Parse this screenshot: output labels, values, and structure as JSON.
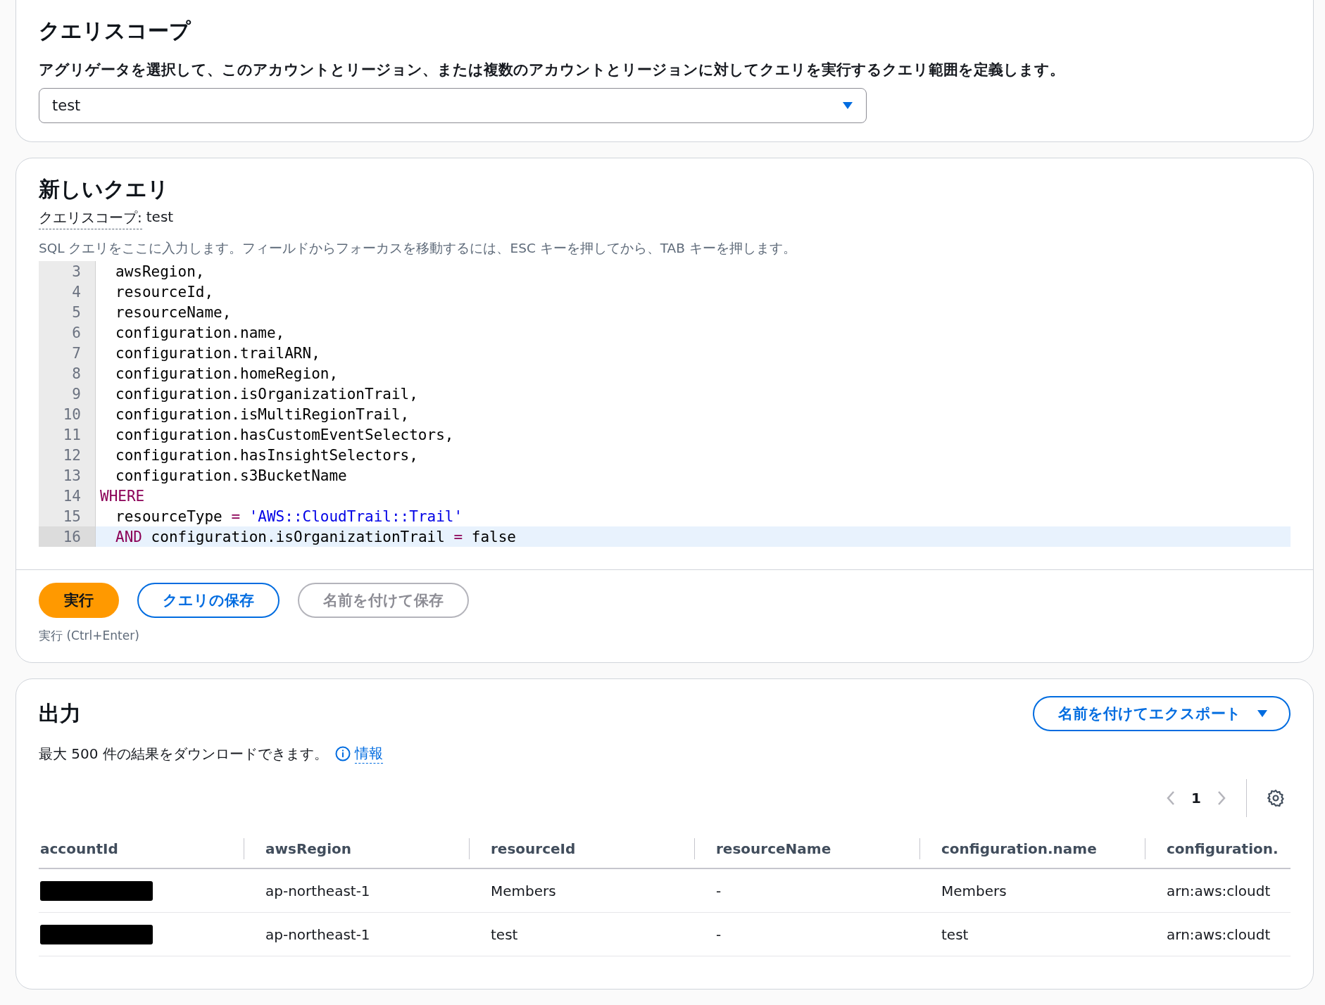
{
  "scope_panel": {
    "title": "クエリスコープ",
    "description": "アグリゲータを選択して、このアカウントとリージョン、または複数のアカウントとリージョンに対してクエリを実行するクエリ範囲を定義します。",
    "select_value": "test"
  },
  "query_panel": {
    "title": "新しいクエリ",
    "scope_label": "クエリスコープ:",
    "scope_value": "test",
    "editor_hint": "SQL クエリをここに入力します。フィールドからフォーカスを移動するには、ESC キーを押してから、TAB キーを押します。",
    "code_lines": [
      {
        "number": "3",
        "indent": true,
        "active": false,
        "tokens": [
          {
            "kind": "plain",
            "text": "awsRegion,"
          }
        ]
      },
      {
        "number": "4",
        "indent": true,
        "active": false,
        "tokens": [
          {
            "kind": "plain",
            "text": "resourceId,"
          }
        ]
      },
      {
        "number": "5",
        "indent": true,
        "active": false,
        "tokens": [
          {
            "kind": "plain",
            "text": "resourceName,"
          }
        ]
      },
      {
        "number": "6",
        "indent": true,
        "active": false,
        "tokens": [
          {
            "kind": "plain",
            "text": "configuration.name,"
          }
        ]
      },
      {
        "number": "7",
        "indent": true,
        "active": false,
        "tokens": [
          {
            "kind": "plain",
            "text": "configuration.trailARN,"
          }
        ]
      },
      {
        "number": "8",
        "indent": true,
        "active": false,
        "tokens": [
          {
            "kind": "plain",
            "text": "configuration.homeRegion,"
          }
        ]
      },
      {
        "number": "9",
        "indent": true,
        "active": false,
        "tokens": [
          {
            "kind": "plain",
            "text": "configuration.isOrganizationTrail,"
          }
        ]
      },
      {
        "number": "10",
        "indent": true,
        "active": false,
        "tokens": [
          {
            "kind": "plain",
            "text": "configuration.isMultiRegionTrail,"
          }
        ]
      },
      {
        "number": "11",
        "indent": true,
        "active": false,
        "tokens": [
          {
            "kind": "plain",
            "text": "configuration.hasCustomEventSelectors,"
          }
        ]
      },
      {
        "number": "12",
        "indent": true,
        "active": false,
        "tokens": [
          {
            "kind": "plain",
            "text": "configuration.hasInsightSelectors,"
          }
        ]
      },
      {
        "number": "13",
        "indent": true,
        "active": false,
        "tokens": [
          {
            "kind": "plain",
            "text": "configuration.s3BucketName"
          }
        ]
      },
      {
        "number": "14",
        "indent": false,
        "active": false,
        "tokens": [
          {
            "kind": "keyword",
            "text": "WHERE"
          }
        ]
      },
      {
        "number": "15",
        "indent": true,
        "active": false,
        "tokens": [
          {
            "kind": "plain",
            "text": "resourceType"
          },
          {
            "kind": "operator",
            "text": "="
          },
          {
            "kind": "string",
            "text": "'AWS::CloudTrail::Trail'"
          }
        ]
      },
      {
        "number": "16",
        "indent": true,
        "active": true,
        "tokens": [
          {
            "kind": "keyword",
            "text": "AND"
          },
          {
            "kind": "plain",
            "text": "configuration.isOrganizationTrail"
          },
          {
            "kind": "operator",
            "text": "="
          },
          {
            "kind": "plain",
            "text": "false"
          }
        ]
      }
    ],
    "buttons": [
      {
        "kind": "primary",
        "label": "実行",
        "disabled": false
      },
      {
        "kind": "normal",
        "label": "クエリの保存",
        "disabled": false
      },
      {
        "kind": "normal",
        "label": "名前を付けて保存",
        "disabled": true
      }
    ],
    "shortcut_hint": "実行 (Ctrl+Enter)"
  },
  "output_panel": {
    "title": "出力",
    "export_button": "名前を付けてエクスポート",
    "description": "最大 500 件の結果をダウンロードできます。",
    "info_link": "情報",
    "page": "1",
    "table": {
      "columns": [
        "accountId",
        "awsRegion",
        "resourceId",
        "resourceName",
        "configuration.name",
        "configuration."
      ],
      "rows": [
        {
          "cells": [
            {
              "redacted": true
            },
            {
              "text": "ap-northeast-1"
            },
            {
              "text": "Members"
            },
            {
              "text": "-"
            },
            {
              "text": "Members"
            },
            {
              "text": "arn:aws:cloudt"
            }
          ]
        },
        {
          "cells": [
            {
              "redacted": true
            },
            {
              "text": "ap-northeast-1"
            },
            {
              "text": "test"
            },
            {
              "text": "-"
            },
            {
              "text": "test"
            },
            {
              "text": "arn:aws:cloudt"
            }
          ]
        }
      ]
    }
  }
}
